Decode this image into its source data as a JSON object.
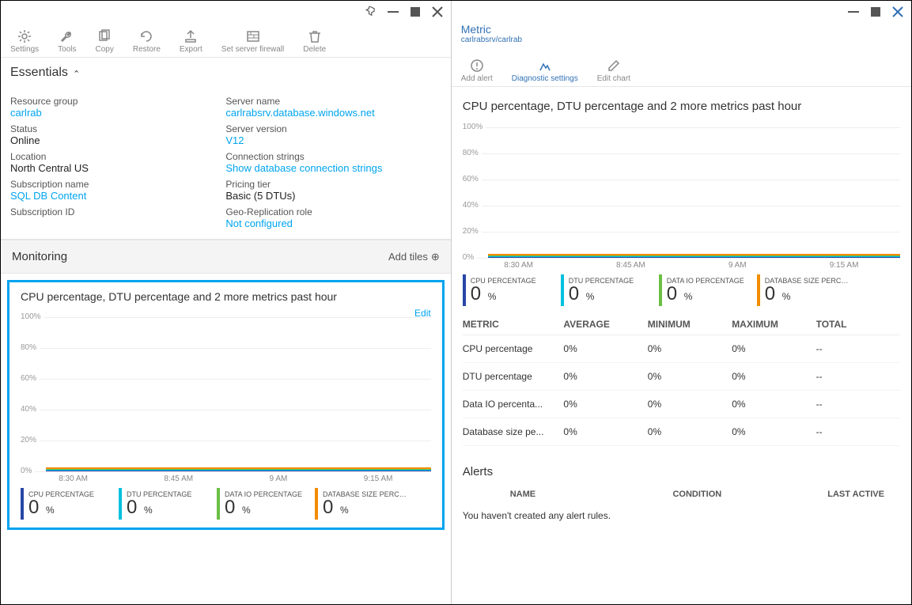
{
  "leftToolbar": [
    {
      "label": "Settings",
      "icon": "gear"
    },
    {
      "label": "Tools",
      "icon": "wrench"
    },
    {
      "label": "Copy",
      "icon": "copy"
    },
    {
      "label": "Restore",
      "icon": "restore"
    },
    {
      "label": "Export",
      "icon": "export"
    },
    {
      "label": "Set server firewall",
      "icon": "firewall"
    },
    {
      "label": "Delete",
      "icon": "delete"
    }
  ],
  "rightHeader": {
    "title": "Metric",
    "sub": "carlrabsrv/carlrab"
  },
  "rightToolbar": [
    {
      "label": "Add alert",
      "icon": "alert",
      "active": false
    },
    {
      "label": "Diagnostic settings",
      "icon": "diag",
      "active": true
    },
    {
      "label": "Edit chart",
      "icon": "edit",
      "active": false
    }
  ],
  "essentials": {
    "heading": "Essentials",
    "left": [
      {
        "label": "Resource group",
        "value": "carlrab",
        "link": true
      },
      {
        "label": "Status",
        "value": "Online",
        "link": false
      },
      {
        "label": "Location",
        "value": "North Central US",
        "link": false
      },
      {
        "label": "Subscription name",
        "value": "SQL DB Content",
        "link": true
      },
      {
        "label": "Subscription ID",
        "value": "",
        "link": false
      }
    ],
    "right": [
      {
        "label": "Server name",
        "value": "carlrabsrv.database.windows.net",
        "link": true
      },
      {
        "label": "Server version",
        "value": "V12",
        "link": true
      },
      {
        "label": "Connection strings",
        "value": "Show database connection strings",
        "link": true
      },
      {
        "label": "Pricing tier",
        "value": "Basic (5 DTUs)",
        "link": false
      },
      {
        "label": "Geo-Replication role",
        "value": "Not configured",
        "link": true
      }
    ]
  },
  "monitoring": {
    "heading": "Monitoring",
    "addTiles": "Add tiles"
  },
  "chart": {
    "title": "CPU percentage, DTU percentage and 2 more metrics past hour",
    "edit": "Edit"
  },
  "chart_data": {
    "type": "line",
    "title": "CPU percentage, DTU percentage and 2 more metrics past hour",
    "yticks": [
      "100%",
      "80%",
      "60%",
      "40%",
      "20%",
      "0%"
    ],
    "xticks": [
      "8:30 AM",
      "8:45 AM",
      "9 AM",
      "9:15 AM"
    ],
    "ylim": [
      0,
      100
    ],
    "series": [
      {
        "name": "CPU PERCENTAGE",
        "color": "#2846A6",
        "current": "0",
        "unit": "%"
      },
      {
        "name": "DTU PERCENTAGE",
        "color": "#00C1DE",
        "current": "0",
        "unit": "%"
      },
      {
        "name": "DATA IO PERCENTAGE",
        "color": "#6BBE44",
        "current": "0",
        "unit": "%"
      },
      {
        "name": "DATABASE SIZE PERCENT...",
        "color": "#F28C00",
        "current": "0",
        "unit": "%"
      }
    ]
  },
  "metricsTable": {
    "headers": [
      "METRIC",
      "AVERAGE",
      "MINIMUM",
      "MAXIMUM",
      "TOTAL"
    ],
    "rows": [
      [
        "CPU percentage",
        "0%",
        "0%",
        "0%",
        "--"
      ],
      [
        "DTU percentage",
        "0%",
        "0%",
        "0%",
        "--"
      ],
      [
        "Data IO percenta...",
        "0%",
        "0%",
        "0%",
        "--"
      ],
      [
        "Database size pe...",
        "0%",
        "0%",
        "0%",
        "--"
      ]
    ]
  },
  "alerts": {
    "heading": "Alerts",
    "headers": [
      "NAME",
      "CONDITION",
      "LAST ACTIVE"
    ],
    "empty": "You haven't created any alert rules."
  }
}
